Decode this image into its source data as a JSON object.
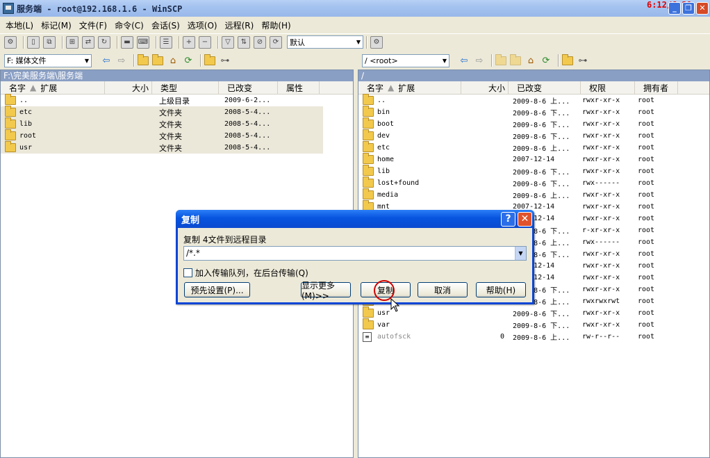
{
  "window": {
    "title": "服务端 - root@192.168.1.6 - WinSCP",
    "clock": "6:12/6:21"
  },
  "menu": [
    "本地(L)",
    "标记(M)",
    "文件(F)",
    "命令(C)",
    "会话(S)",
    "选项(O)",
    "远程(R)",
    "帮助(H)"
  ],
  "toolbar": {
    "profile_value": "默认"
  },
  "left": {
    "drive": "F: 媒体文件",
    "path": "F:\\完美服务端\\服务端",
    "headers": [
      "名字",
      "扩展",
      "大小",
      "类型",
      "已改变",
      "属性"
    ],
    "rows": [
      {
        "name": "..",
        "type": "上级目录",
        "changed": "2009-6-2..."
      },
      {
        "name": "etc",
        "type": "文件夹",
        "changed": "2008-5-4..."
      },
      {
        "name": "lib",
        "type": "文件夹",
        "changed": "2008-5-4..."
      },
      {
        "name": "root",
        "type": "文件夹",
        "changed": "2008-5-4..."
      },
      {
        "name": "usr",
        "type": "文件夹",
        "changed": "2008-5-4..."
      }
    ]
  },
  "right": {
    "dir": "/ <root>",
    "path": "/",
    "headers": [
      "名字",
      "扩展",
      "大小",
      "已改变",
      "权限",
      "拥有者"
    ],
    "rows": [
      {
        "name": "..",
        "size": "",
        "changed": "2009-8-6 上...",
        "perm": "rwxr-xr-x",
        "owner": "root"
      },
      {
        "name": "bin",
        "size": "",
        "changed": "2009-8-6 下...",
        "perm": "rwxr-xr-x",
        "owner": "root"
      },
      {
        "name": "boot",
        "size": "",
        "changed": "2009-8-6 下...",
        "perm": "rwxr-xr-x",
        "owner": "root"
      },
      {
        "name": "dev",
        "size": "",
        "changed": "2009-8-6 下...",
        "perm": "rwxr-xr-x",
        "owner": "root"
      },
      {
        "name": "etc",
        "size": "",
        "changed": "2009-8-6 上...",
        "perm": "rwxr-xr-x",
        "owner": "root"
      },
      {
        "name": "home",
        "size": "",
        "changed": "2007-12-14",
        "perm": "rwxr-xr-x",
        "owner": "root"
      },
      {
        "name": "lib",
        "size": "",
        "changed": "2009-8-6 下...",
        "perm": "rwxr-xr-x",
        "owner": "root"
      },
      {
        "name": "lost+found",
        "size": "",
        "changed": "2009-8-6 下...",
        "perm": "rwx------",
        "owner": "root"
      },
      {
        "name": "media",
        "size": "",
        "changed": "2009-8-6 上...",
        "perm": "rwxr-xr-x",
        "owner": "root"
      },
      {
        "name": "mnt",
        "size": "",
        "changed": "2007-12-14",
        "perm": "rwxr-xr-x",
        "owner": "root"
      },
      {
        "name": "",
        "size": "",
        "changed": "2007-12-14",
        "perm": "rwxr-xr-x",
        "owner": "root"
      },
      {
        "name": "",
        "size": "",
        "changed": "2009-8-6 下...",
        "perm": "r-xr-xr-x",
        "owner": "root"
      },
      {
        "name": "",
        "size": "",
        "changed": "2009-8-6 上...",
        "perm": "rwx------",
        "owner": "root"
      },
      {
        "name": "",
        "size": "",
        "changed": "2009-8-6 下...",
        "perm": "rwxr-xr-x",
        "owner": "root"
      },
      {
        "name": "",
        "size": "",
        "changed": "2007-12-14",
        "perm": "rwxr-xr-x",
        "owner": "root"
      },
      {
        "name": "",
        "size": "",
        "changed": "2007-12-14",
        "perm": "rwxr-xr-x",
        "owner": "root"
      },
      {
        "name": "",
        "size": "",
        "changed": "2009-8-6 下...",
        "perm": "rwxr-xr-x",
        "owner": "root"
      },
      {
        "name": "",
        "size": "",
        "changed": "2009-8-6 上...",
        "perm": "rwxrwxrwt",
        "owner": "root"
      },
      {
        "name": "usr",
        "size": "",
        "changed": "2009-8-6 下...",
        "perm": "rwxr-xr-x",
        "owner": "root"
      },
      {
        "name": "var",
        "size": "",
        "changed": "2009-8-6 下...",
        "perm": "rwxr-xr-x",
        "owner": "root"
      },
      {
        "name": "autofsck",
        "size": "0",
        "changed": "2009-8-6 上...",
        "perm": "rw-r--r--",
        "owner": "root"
      }
    ]
  },
  "dialog": {
    "title": "复制",
    "label": "复制 4文件到远程目录",
    "target": "/*.*",
    "queue_checkbox": "加入传输队列，在后台传输(Q)",
    "buttons": {
      "preset": "预先设置(P)...",
      "more": "显示更多(M)>>",
      "copy": "复制",
      "cancel": "取消",
      "help": "帮助(H)"
    }
  }
}
